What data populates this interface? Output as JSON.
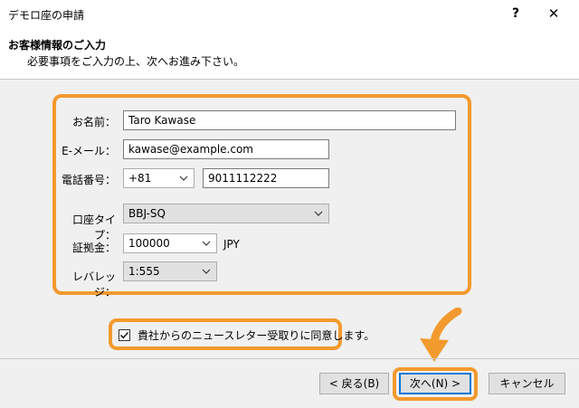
{
  "window": {
    "title": "デモロ座の申請",
    "help_label": "?",
    "close_label": "✕"
  },
  "header": {
    "title": "お客様情報のご入力",
    "subtitle": "必要事項をご入力の上、次へお進み下さい。"
  },
  "form": {
    "name_label": "お名前：",
    "name_value": "Taro Kawase",
    "email_label": "E-メール：",
    "email_value": "kawase@example.com",
    "phone_label": "電話番号：",
    "phone_country_code": "+81",
    "phone_number": "9011112222",
    "account_type_label": "口座タイプ：",
    "account_type_value": "BBJ-SQ",
    "deposit_label": "証拠金：",
    "deposit_value": "100000",
    "deposit_currency": "JPY",
    "leverage_label": "レバレッジ：",
    "leverage_value": "1:555"
  },
  "newsletter": {
    "label": "貴社からのニュースレター受取りに同意します。",
    "checked": true
  },
  "footer": {
    "back_label": "< 戻る(B)",
    "next_label": "次へ(N) >",
    "cancel_label": "キャンセル"
  },
  "colors": {
    "highlight": "#f29a2e",
    "focus_border": "#0078d7"
  }
}
